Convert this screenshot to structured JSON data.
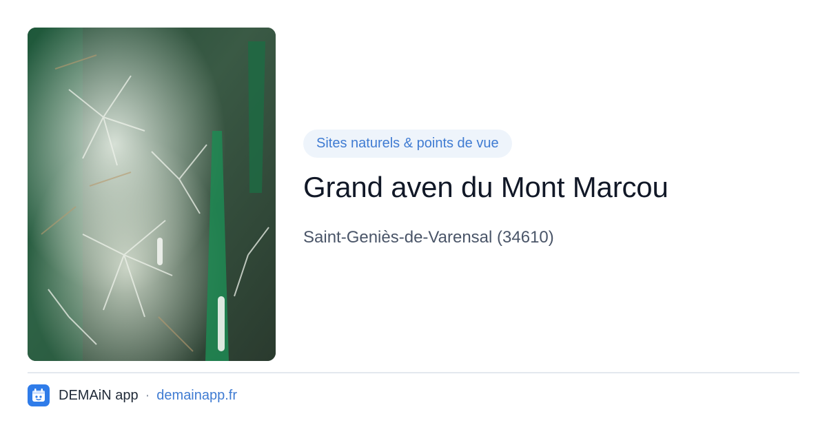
{
  "card": {
    "image": {
      "alt": "",
      "icon": "cave-crystals-photo"
    },
    "category": "Sites naturels & points de vue",
    "title": "Grand aven du Mont Marcou",
    "location": "Saint-Geniès-de-Varensal (34610)"
  },
  "footer": {
    "app_icon": "demain-app-logo-icon",
    "app_name": "DEMAiN app",
    "separator": "·",
    "domain": "demainapp.fr"
  },
  "colors": {
    "accent": "#3f7bd2",
    "pill_background": "#eef4fb",
    "title": "#111827",
    "subtitle": "#4a5568",
    "app_icon_background": "#2f7ce9"
  }
}
